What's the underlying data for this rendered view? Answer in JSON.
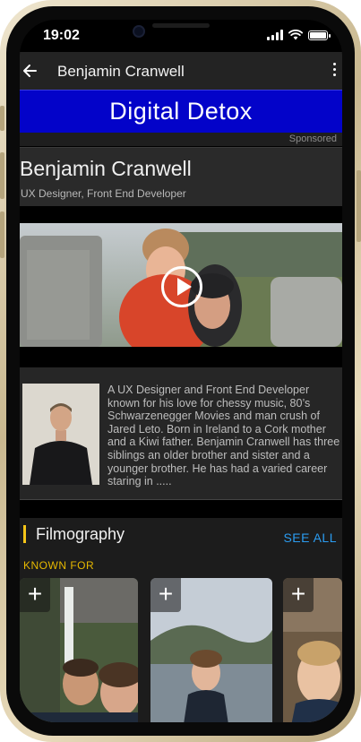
{
  "status_bar": {
    "time": "19:02"
  },
  "app_bar": {
    "title": "Benjamin Cranwell"
  },
  "ad": {
    "text": "Digital Detox",
    "sponsored_label": "Sponsored"
  },
  "profile": {
    "name": "Benjamin Cranwell",
    "role": "UX Designer, Front End Developer"
  },
  "bio": {
    "text": "A UX Designer and Front End Developer known for his love for chessy music, 80’s Schwarzenegger Movies and man crush of Jared Leto. Born in Ireland to a Cork mother and a Kiwi father. Benjamin Cranwell has three siblings an older brother and sister and a younger brother. He has had a varied career staring in ....."
  },
  "filmography": {
    "title": "Filmography",
    "see_all": "SEE ALL",
    "known_for": "KNOWN FOR",
    "add_symbol": "+"
  },
  "colors": {
    "ad_background": "#0303c9",
    "accent_yellow": "#f5c518",
    "link_blue": "#2b9cf0",
    "app_bar": "#232323",
    "frame_gold": "#c9b890"
  },
  "icons": [
    "back-arrow-icon",
    "overflow-menu-icon",
    "play-icon",
    "add-icon",
    "signal-icon",
    "wifi-icon",
    "battery-icon",
    "camera-icon"
  ]
}
